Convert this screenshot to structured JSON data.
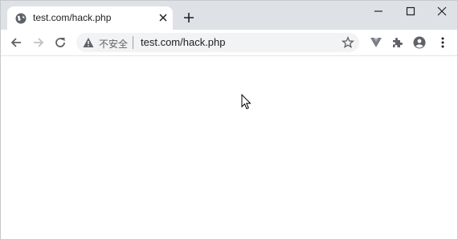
{
  "tab": {
    "title": "test.com/hack.php"
  },
  "omnibox": {
    "security_label": "不安全",
    "url": "test.com/hack.php"
  },
  "icons": {
    "favicon": "globe-icon",
    "tab_close": "close-icon",
    "new_tab": "plus-icon",
    "minimize": "minimize-icon",
    "maximize": "maximize-icon",
    "close_window": "close-icon",
    "back": "arrow-left-icon",
    "forward": "arrow-right-icon",
    "reload": "reload-icon",
    "warning": "warning-icon",
    "bookmark": "star-icon",
    "extension_v": "vue-extension-icon",
    "extensions": "puzzle-icon",
    "profile": "account-icon",
    "menu": "kebab-menu-icon",
    "pointer": "mouse-cursor-icon"
  },
  "colors": {
    "tabstrip": "#dee1e6",
    "omnibox": "#f1f3f4",
    "icon": "#5f6368"
  }
}
